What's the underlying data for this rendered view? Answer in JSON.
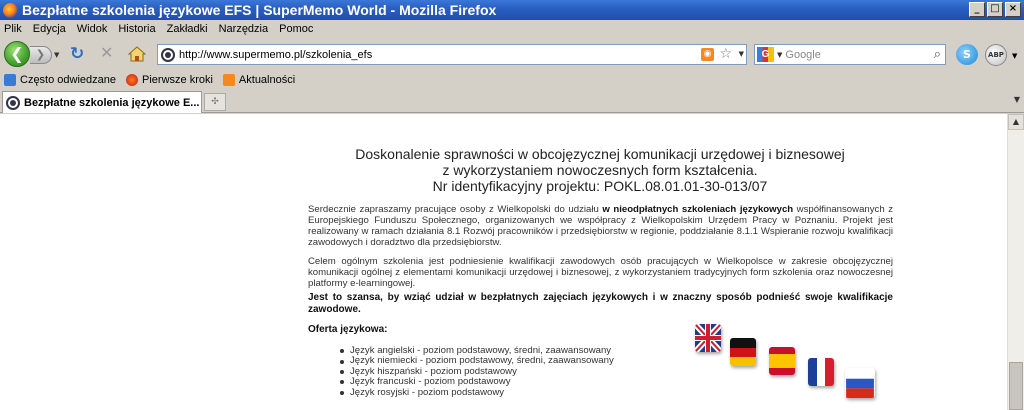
{
  "window": {
    "title": "Bezpłatne szkolenia językowe EFS | SuperMemo World - Mozilla Firefox",
    "controls": [
      "_",
      "□",
      "×"
    ]
  },
  "menu": [
    "Plik",
    "Edycja",
    "Widok",
    "Historia",
    "Zakładki",
    "Narzędzia",
    "Pomoc"
  ],
  "nav": {
    "url": "http://www.supermemo.pl/szkolenia_efs",
    "search_placeholder": "Google",
    "search_engine": "G"
  },
  "bookmarks": [
    {
      "label": "Często odwiedzane",
      "icon": "folder-icon"
    },
    {
      "label": "Pierwsze kroki",
      "icon": "firefox-icon"
    },
    {
      "label": "Aktualności",
      "icon": "rss-icon"
    }
  ],
  "tab": {
    "label": "Bezpłatne szkolenia językowe E..."
  },
  "page": {
    "headline": [
      "Doskonalenie sprawności w obcojęzycznej komunikacji urzędowej i biznesowej",
      "z wykorzystaniem nowoczesnych form kształcenia.",
      "Nr identyfikacyjny projektu: POKL.08.01.01-30-013/07"
    ],
    "para1_before": "Serdecznie zapraszamy pracujące osoby z Wielkopolski do udziału ",
    "para1_bold": "w nieodpłatnych szkoleniach językowych",
    "para1_after": " współfinansowanych z Europejskiego Funduszu Społecznego, organizowanych we współpracy z Wielkopolskim Urzędem Pracy w Poznaniu. Projekt jest realizowany w ramach działania 8.1 Rozwój pracowników i przedsiębiorstw w regionie, poddziałanie 8.1.1 Wspieranie rozwoju kwalifikacji zawodowych i doradztwo dla przedsiębiorstw.",
    "para2": "Celem ogólnym szkolenia jest podniesienie kwalifikacji zawodowych osób pracujących w Wielkopolsce w zakresie obcojęzycznej komunikacji ogólnej z elementami komunikacji urzędowej i biznesowej, z wykorzystaniem tradycyjnych form szkolenia oraz nowoczesnej platformy e-learningowej.",
    "para3": "Jest to szansa, by wziąć udział w bezpłatnych zajęciach językowych i w znaczny sposób podnieść swoje kwalifikacje zawodowe.",
    "offer_title": "Oferta językowa:",
    "offer": [
      "Język angielski - poziom podstawowy, średni, zaawansowany",
      "Język niemiecki - poziom podstawowy, średni, zaawansowany",
      "Język hiszpański - poziom podstawowy",
      "Język francuski - poziom podstawowy",
      "Język rosyjski - poziom podstawowy"
    ],
    "flags": [
      "uk-flag-icon",
      "germany-flag-icon",
      "spain-flag-icon",
      "france-flag-icon",
      "russia-flag-icon"
    ]
  }
}
